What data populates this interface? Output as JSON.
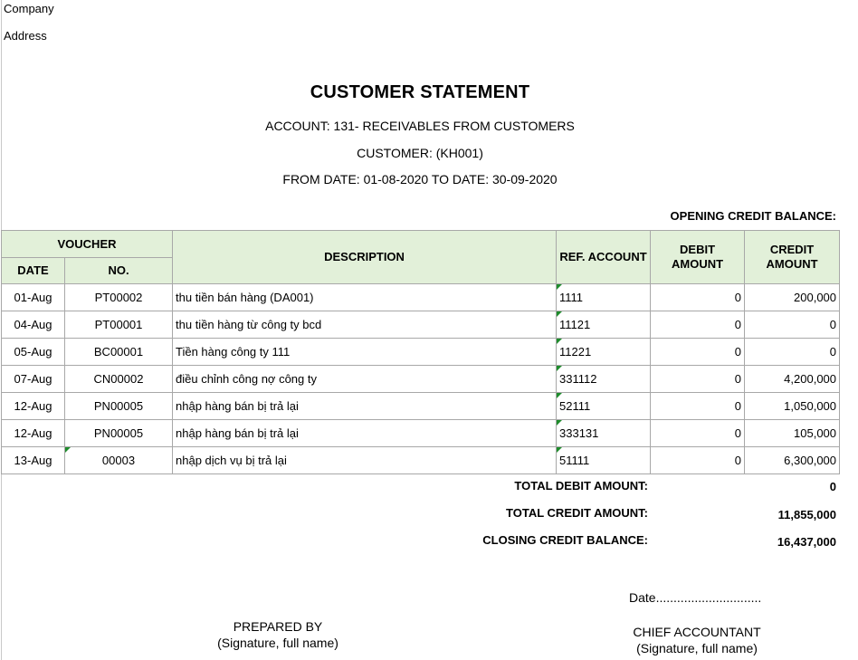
{
  "header": {
    "company_label": "Company",
    "address_label": "Address"
  },
  "statement": {
    "title": "CUSTOMER STATEMENT",
    "account_line": "ACCOUNT: 131- RECEIVABLES FROM CUSTOMERS",
    "customer_line": "CUSTOMER:  (KH001)",
    "period_line": "FROM DATE: 01-08-2020 TO DATE: 30-09-2020",
    "opening_label": "OPENING CREDIT BALANCE:"
  },
  "table": {
    "headers": {
      "voucher": "VOUCHER",
      "date": "DATE",
      "no": "NO.",
      "description": "DESCRIPTION",
      "ref_account": "REF. ACCOUNT",
      "debit": "DEBIT AMOUNT",
      "credit": "CREDIT AMOUNT"
    },
    "rows": [
      {
        "date": "01-Aug",
        "no": "PT00002",
        "description": "thu tiền bán hàng (DA001)",
        "ref": "1111",
        "debit": "0",
        "credit": "200,000"
      },
      {
        "date": "04-Aug",
        "no": "PT00001",
        "description": "thu tiền hàng từ công ty bcd",
        "ref": "11121",
        "debit": "0",
        "credit": "0"
      },
      {
        "date": "05-Aug",
        "no": "BC00001",
        "description": "Tiền hàng công ty 111",
        "ref": "11221",
        "debit": "0",
        "credit": "0"
      },
      {
        "date": "07-Aug",
        "no": "CN00002",
        "description": "điều chỉnh công nợ công ty",
        "ref": "331112",
        "debit": "0",
        "credit": "4,200,000"
      },
      {
        "date": "12-Aug",
        "no": "PN00005",
        "description": "nhập hàng bán bị trả lại",
        "ref": "52111",
        "debit": "0",
        "credit": "1,050,000"
      },
      {
        "date": "12-Aug",
        "no": "PN00005",
        "description": "nhập hàng bán bị trả lại",
        "ref": "333131",
        "debit": "0",
        "credit": "105,000"
      },
      {
        "date": "13-Aug",
        "no": "00003",
        "description": "nhập dịch vụ bị trả lại",
        "ref": "51111",
        "debit": "0",
        "credit": "6,300,000"
      }
    ]
  },
  "totals": {
    "total_debit_label": "TOTAL DEBIT AMOUNT:",
    "total_debit_value": "0",
    "total_credit_label": "TOTAL CREDIT AMOUNT:",
    "total_credit_value": "11,855,000",
    "closing_label": "CLOSING CREDIT BALANCE:",
    "closing_value": "16,437,000"
  },
  "signatures": {
    "date_line": "Date..............................",
    "prepared_by": "PREPARED BY",
    "prepared_note": "(Signature, full name)",
    "chief_accountant": "CHIEF ACCOUNTANT",
    "chief_note": "(Signature, full name)"
  },
  "colors": {
    "header_fill": "#e2f0d9",
    "flag_marker": "#1e8c2c"
  }
}
